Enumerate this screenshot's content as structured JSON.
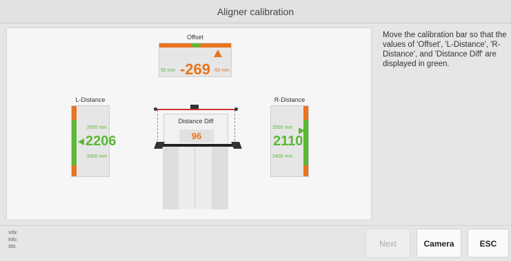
{
  "window": {
    "title": "Aligner calibration"
  },
  "instructions": "Move the calibration bar so that the values of 'Offset', 'L-Distance', 'R-Distance', and 'Distance Diff' are displayed in green.",
  "offset": {
    "label": "Offset",
    "value": "-269",
    "min": "50 mm",
    "max": "-50 mm",
    "value_color": "#e8741f"
  },
  "l_distance": {
    "label": "L-Distance",
    "value": "2206",
    "min": "2000 mm",
    "max": "2400 mm",
    "value_color": "#5cb836"
  },
  "r_distance": {
    "label": "R-Distance",
    "value": "2110",
    "min": "2000 mm",
    "max": "2400 mm",
    "value_color": "#5cb836"
  },
  "distance_diff": {
    "label": "Distance Diff",
    "value": "96",
    "value_color": "#e8741f"
  },
  "footer": {
    "vin_label": "VIN:",
    "info_label": "Info:",
    "sn_label": "SN:"
  },
  "buttons": {
    "next": "Next",
    "camera": "Camera",
    "esc": "ESC"
  },
  "colors": {
    "ok": "#5cb836",
    "warn": "#e8741f"
  }
}
